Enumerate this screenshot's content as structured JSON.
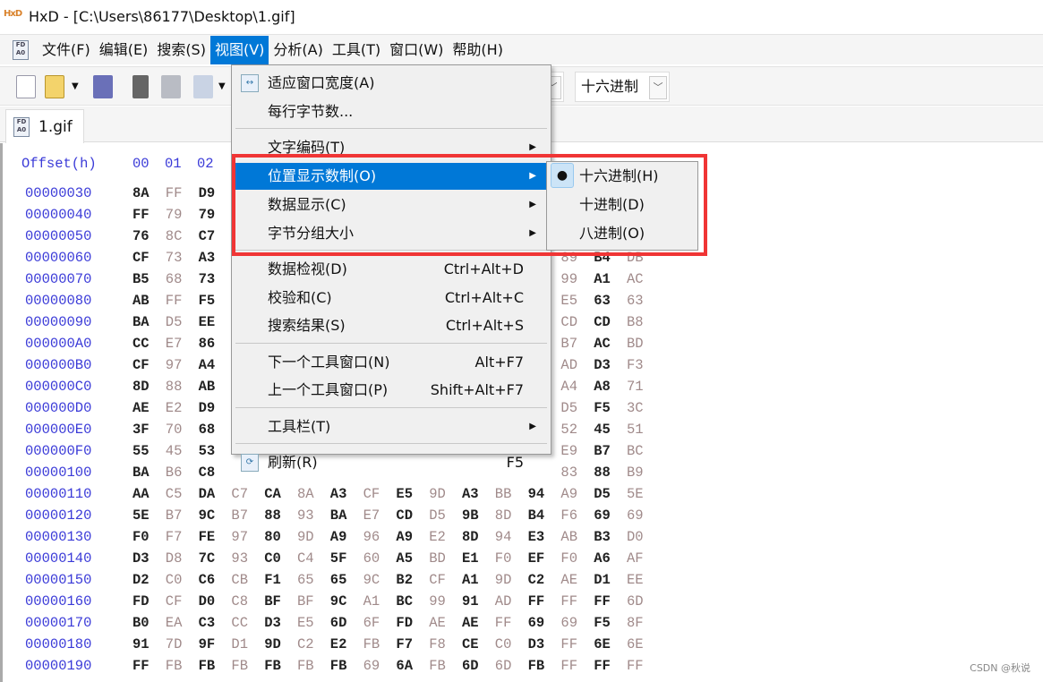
{
  "window": {
    "title": "HxD - [C:\\Users\\86177\\Desktop\\1.gif]",
    "app_logo": "HxD"
  },
  "menubar": {
    "items": [
      "文件(F)",
      "编辑(E)",
      "搜索(S)",
      "视图(V)",
      "分析(A)",
      "工具(T)",
      "窗口(W)",
      "帮助(H)"
    ],
    "active": "视图(V)"
  },
  "toolbar": {
    "offset_base_combo": "十六进制"
  },
  "tab": {
    "label": "1.gif"
  },
  "hex": {
    "header_label": "Offset(h)",
    "header_cols": [
      "00",
      "01",
      "02"
    ],
    "rows": [
      {
        "offset": "00000030",
        "bytes": [
          "8A",
          "FF",
          "D9",
          "",
          "",
          "",
          "",
          "",
          "",
          "",
          "",
          "",
          "",
          "",
          "",
          ""
        ]
      },
      {
        "offset": "00000040",
        "bytes": [
          "FF",
          "79",
          "79",
          "",
          "",
          "",
          "",
          "",
          "",
          "",
          "",
          "",
          "",
          "",
          "",
          ""
        ]
      },
      {
        "offset": "00000050",
        "bytes": [
          "76",
          "8C",
          "C7",
          "",
          "",
          "",
          "",
          "",
          "",
          "",
          "",
          "",
          "",
          "",
          "",
          ""
        ]
      },
      {
        "offset": "00000060",
        "bytes": [
          "CF",
          "73",
          "A3",
          "",
          "",
          "",
          "",
          "",
          "",
          "",
          "",
          "",
          "",
          "89",
          "B4",
          "DB"
        ]
      },
      {
        "offset": "00000070",
        "bytes": [
          "B5",
          "68",
          "73",
          "",
          "",
          "",
          "",
          "",
          "",
          "",
          "",
          "",
          "",
          "99",
          "A1",
          "AC"
        ]
      },
      {
        "offset": "00000080",
        "bytes": [
          "AB",
          "FF",
          "F5",
          "",
          "",
          "",
          "",
          "",
          "",
          "",
          "",
          "",
          "",
          "E5",
          "63",
          "63"
        ]
      },
      {
        "offset": "00000090",
        "bytes": [
          "BA",
          "D5",
          "EE",
          "",
          "",
          "",
          "",
          "",
          "",
          "",
          "",
          "",
          "",
          "CD",
          "CD",
          "B8"
        ]
      },
      {
        "offset": "000000A0",
        "bytes": [
          "CC",
          "E7",
          "86",
          "",
          "",
          "",
          "",
          "",
          "",
          "",
          "",
          "",
          "",
          "B7",
          "AC",
          "BD"
        ]
      },
      {
        "offset": "000000B0",
        "bytes": [
          "CF",
          "97",
          "A4",
          "",
          "",
          "",
          "",
          "",
          "",
          "",
          "",
          "",
          "",
          "AD",
          "D3",
          "F3"
        ]
      },
      {
        "offset": "000000C0",
        "bytes": [
          "8D",
          "88",
          "AB",
          "",
          "",
          "",
          "",
          "",
          "",
          "",
          "",
          "",
          "",
          "A4",
          "A8",
          "71"
        ]
      },
      {
        "offset": "000000D0",
        "bytes": [
          "AE",
          "E2",
          "D9",
          "",
          "",
          "",
          "",
          "",
          "",
          "",
          "",
          "",
          "",
          "D5",
          "F5",
          "3C"
        ]
      },
      {
        "offset": "000000E0",
        "bytes": [
          "3F",
          "70",
          "68",
          "",
          "",
          "",
          "",
          "",
          "",
          "",
          "",
          "",
          "",
          "52",
          "45",
          "51"
        ]
      },
      {
        "offset": "000000F0",
        "bytes": [
          "55",
          "45",
          "53",
          "",
          "",
          "",
          "",
          "",
          "",
          "",
          "",
          "",
          "",
          "E9",
          "B7",
          "BC"
        ]
      },
      {
        "offset": "00000100",
        "bytes": [
          "BA",
          "B6",
          "C8",
          "",
          "",
          "",
          "",
          "",
          "",
          "",
          "",
          "",
          "",
          "83",
          "88",
          "B9"
        ]
      },
      {
        "offset": "00000110",
        "bytes": [
          "AA",
          "C5",
          "DA",
          "C7",
          "CA",
          "8A",
          "A3",
          "CF",
          "E5",
          "9D",
          "A3",
          "BB",
          "94",
          "A9",
          "D5",
          "5E"
        ]
      },
      {
        "offset": "00000120",
        "bytes": [
          "5E",
          "B7",
          "9C",
          "B7",
          "88",
          "93",
          "BA",
          "E7",
          "CD",
          "D5",
          "9B",
          "8D",
          "B4",
          "F6",
          "69",
          "69"
        ]
      },
      {
        "offset": "00000130",
        "bytes": [
          "F0",
          "F7",
          "FE",
          "97",
          "80",
          "9D",
          "A9",
          "96",
          "A9",
          "E2",
          "8D",
          "94",
          "E3",
          "AB",
          "B3",
          "D0"
        ]
      },
      {
        "offset": "00000140",
        "bytes": [
          "D3",
          "D8",
          "7C",
          "93",
          "C0",
          "C4",
          "5F",
          "60",
          "A5",
          "BD",
          "E1",
          "F0",
          "EF",
          "F0",
          "A6",
          "AF"
        ]
      },
      {
        "offset": "00000150",
        "bytes": [
          "D2",
          "C0",
          "C6",
          "CB",
          "F1",
          "65",
          "65",
          "9C",
          "B2",
          "CF",
          "A1",
          "9D",
          "C2",
          "AE",
          "D1",
          "EE"
        ]
      },
      {
        "offset": "00000160",
        "bytes": [
          "FD",
          "CF",
          "D0",
          "C8",
          "BF",
          "BF",
          "9C",
          "A1",
          "BC",
          "99",
          "91",
          "AD",
          "FF",
          "FF",
          "FF",
          "6D"
        ]
      },
      {
        "offset": "00000170",
        "bytes": [
          "B0",
          "EA",
          "C3",
          "CC",
          "D3",
          "E5",
          "6D",
          "6F",
          "FD",
          "AE",
          "AE",
          "FF",
          "69",
          "69",
          "F5",
          "8F"
        ]
      },
      {
        "offset": "00000180",
        "bytes": [
          "91",
          "7D",
          "9F",
          "D1",
          "9D",
          "C2",
          "E2",
          "FB",
          "F7",
          "F8",
          "CE",
          "C0",
          "D3",
          "FF",
          "6E",
          "6E"
        ]
      },
      {
        "offset": "00000190",
        "bytes": [
          "FF",
          "FB",
          "FB",
          "FB",
          "FB",
          "FB",
          "FB",
          "69",
          "6A",
          "FB",
          "6D",
          "6D",
          "FB",
          "FF",
          "FF",
          "FF"
        ]
      }
    ]
  },
  "view_menu": {
    "items": [
      {
        "label": "适应窗口宽度(A)",
        "icon": "fit-width-icon"
      },
      {
        "label": "每行字节数..."
      },
      {
        "label": "文字编码(T)",
        "submenu": true
      },
      {
        "label": "位置显示数制(O)",
        "submenu": true,
        "highlighted": true
      },
      {
        "label": "数据显示(C)",
        "submenu": true
      },
      {
        "label": "字节分组大小",
        "submenu": true
      },
      {
        "label": "数据检视(D)",
        "shortcut": "Ctrl+Alt+D"
      },
      {
        "label": "校验和(C)",
        "shortcut": "Ctrl+Alt+C"
      },
      {
        "label": "搜索结果(S)",
        "shortcut": "Ctrl+Alt+S"
      },
      {
        "label": "下一个工具窗口(N)",
        "shortcut": "Alt+F7"
      },
      {
        "label": "上一个工具窗口(P)",
        "shortcut": "Shift+Alt+F7"
      },
      {
        "label": "工具栏(T)",
        "submenu": true
      },
      {
        "label": "刷新(R)",
        "shortcut": "F5",
        "icon": "refresh-icon"
      }
    ]
  },
  "offset_base_submenu": {
    "items": [
      {
        "label": "十六进制(H)",
        "checked": true
      },
      {
        "label": "十进制(D)"
      },
      {
        "label": "八进制(O)"
      }
    ]
  },
  "highlight_color": "#f03535",
  "accent_color": "#0078d7",
  "watermark": "CSDN @秋说"
}
